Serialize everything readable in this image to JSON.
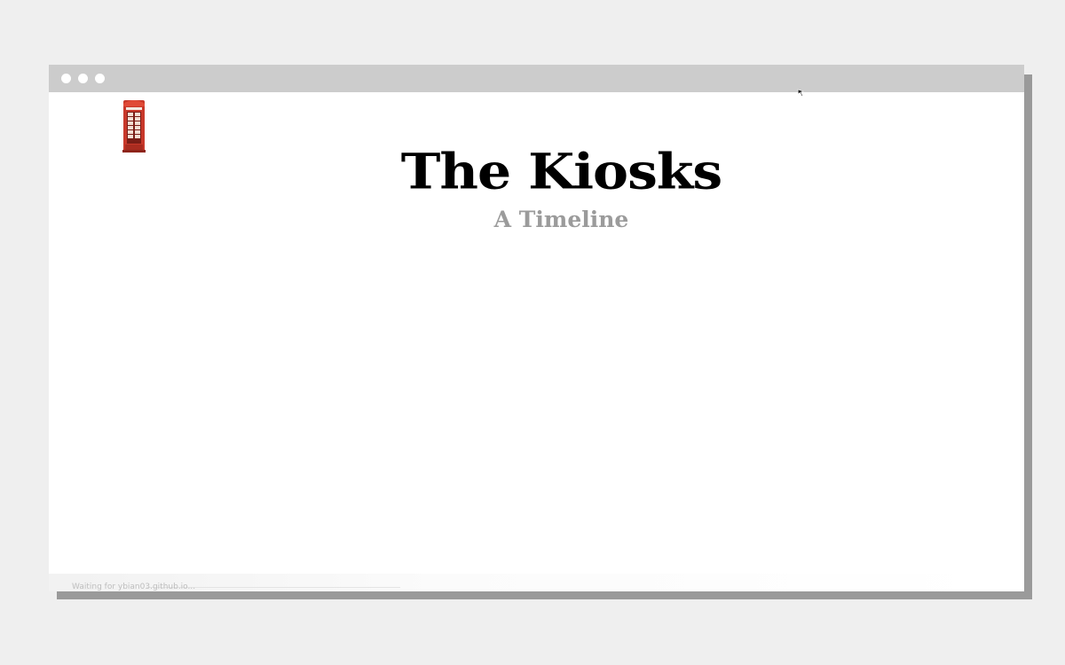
{
  "window": {
    "controls": [
      "close-dot",
      "minimize-dot",
      "maximize-dot"
    ]
  },
  "page": {
    "title": "The Kiosks",
    "subtitle": "A Timeline",
    "title_color": "#000000",
    "subtitle_color": "#9b9b9b",
    "icon": "red-telephone-kiosk-icon"
  },
  "status_bar": {
    "text": "Waiting for ybian03.github.io..."
  },
  "colors": {
    "desktop": "#efefef",
    "titlebar": "#cccccc",
    "shadow": "#9a9a9a",
    "kiosk_red": "#d9442f"
  }
}
